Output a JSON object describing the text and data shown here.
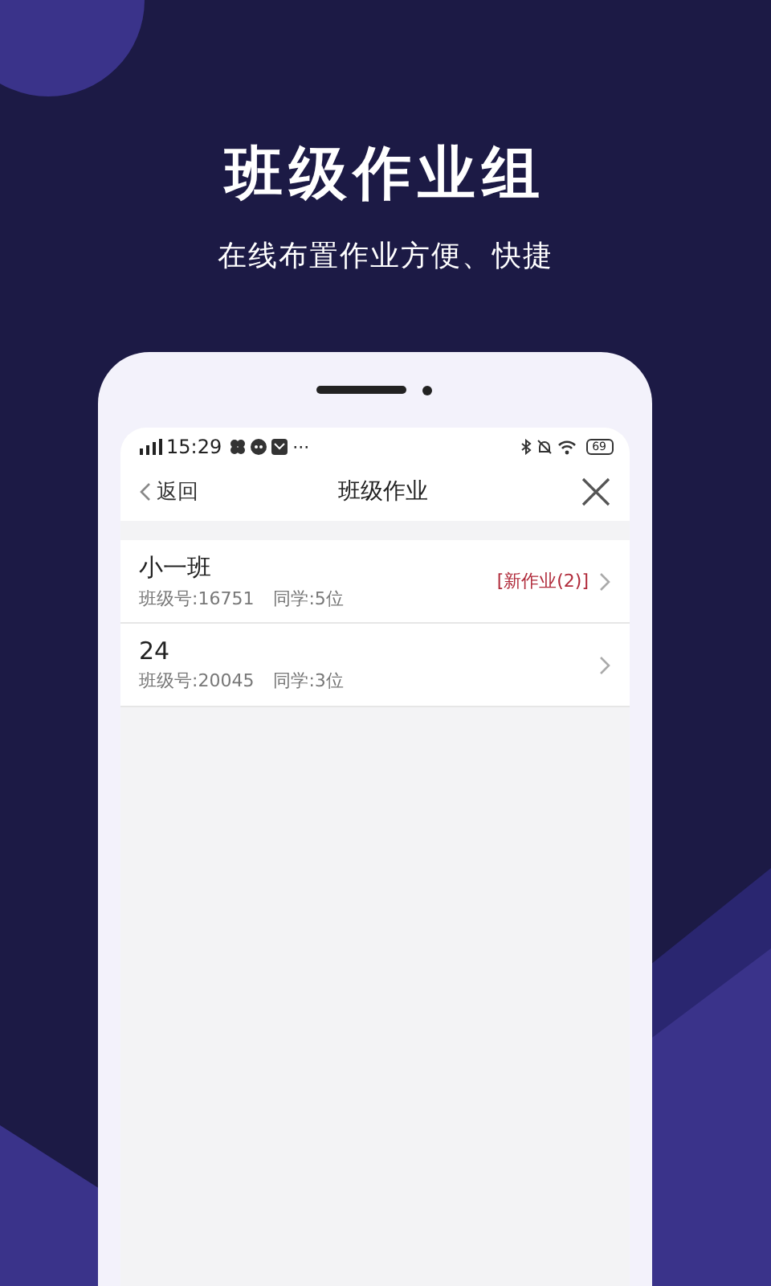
{
  "headline": {
    "title": "班级作业组",
    "subtitle": "在线布置作业方便、快捷"
  },
  "status_bar": {
    "time": "15:29",
    "more": "···",
    "battery": "69"
  },
  "nav": {
    "back": "返回",
    "title": "班级作业"
  },
  "classes": [
    {
      "name": "小一班",
      "class_no": "班级号:16751",
      "students": "同学:5位",
      "badge": "[新作业(2)]"
    },
    {
      "name": "24",
      "class_no": "班级号:20045",
      "students": "同学:3位"
    }
  ]
}
